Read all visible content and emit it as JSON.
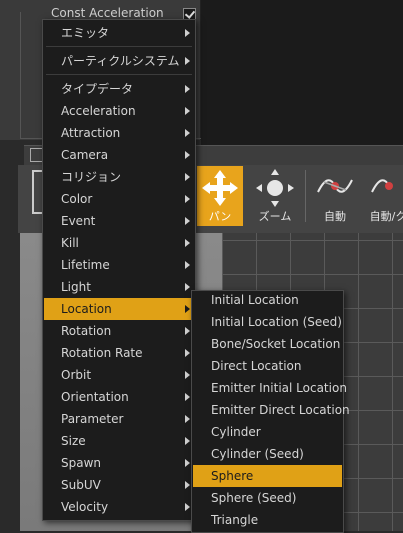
{
  "background_panel": {
    "const_acceleration_label": "Const Acceleration"
  },
  "toolbar": {
    "pan_label": "パン",
    "zoom_label": "ズーム",
    "auto_label": "自動",
    "auto_refresh_label": "自動/ク"
  },
  "main_menu": {
    "items": [
      {
        "label": "エミッタ"
      },
      {
        "label": "パーティクルシステム"
      },
      {
        "label": "タイプデータ"
      },
      {
        "label": "Acceleration"
      },
      {
        "label": "Attraction"
      },
      {
        "label": "Camera"
      },
      {
        "label": "コリジョン"
      },
      {
        "label": "Color"
      },
      {
        "label": "Event"
      },
      {
        "label": "Kill"
      },
      {
        "label": "Lifetime"
      },
      {
        "label": "Light"
      },
      {
        "label": "Location"
      },
      {
        "label": "Rotation"
      },
      {
        "label": "Rotation Rate"
      },
      {
        "label": "Orbit"
      },
      {
        "label": "Orientation"
      },
      {
        "label": "Parameter"
      },
      {
        "label": "Size"
      },
      {
        "label": "Spawn"
      },
      {
        "label": "SubUV"
      },
      {
        "label": "Velocity"
      }
    ],
    "highlighted": "Location"
  },
  "location_submenu": {
    "items": [
      {
        "label": "Initial Location"
      },
      {
        "label": "Initial Location (Seed)"
      },
      {
        "label": "Bone/Socket Location"
      },
      {
        "label": "Direct Location"
      },
      {
        "label": "Emitter Initial Location"
      },
      {
        "label": "Emitter Direct Location"
      },
      {
        "label": "Cylinder"
      },
      {
        "label": "Cylinder (Seed)"
      },
      {
        "label": "Sphere"
      },
      {
        "label": "Sphere (Seed)"
      },
      {
        "label": "Triangle"
      }
    ],
    "highlighted": "Sphere"
  },
  "colors": {
    "highlight": "#e0a116",
    "menu_bg": "#1c1c1c"
  }
}
